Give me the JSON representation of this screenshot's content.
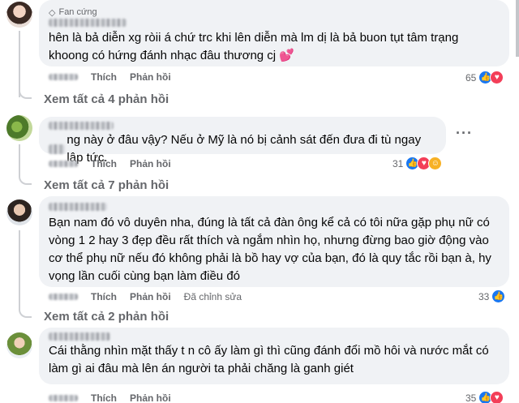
{
  "comments": [
    {
      "badge": "Fan cứng",
      "text": "hên là bả diễn xg ròii á chứ trc khi lên diễn mà lm dị là bả buon tụt tâm trạng khoong có hứng đánh nhạc đâu thương cj 💕",
      "like_label": "Thích",
      "reply_label": "Phản hồi",
      "reaction_count": "65",
      "view_replies": "Xem tất cả 4 phản hồi"
    },
    {
      "text": "ng này ở đâu vậy? Nếu ở Mỹ là nó bị cảnh sát đến đưa đi tù ngay lập tức.",
      "like_label": "Thích",
      "reply_label": "Phản hồi",
      "reaction_count": "31",
      "view_replies": "Xem tất cả 7 phản hồi"
    },
    {
      "text": "Bạn nam đó vô duyên nha, đúng là tất cả đàn ông kể cả có tôi nữa gặp phụ nữ có vòng 1 2 hay 3 đẹp đều rất thích và ngắm nhìn họ, nhưng đừng bao giờ động vào cơ thể phụ nữ nếu đó không phải là bồ hay vợ của bạn, đó là quy tắc rồi bạn à, hy vọng lần cuối cùng bạn làm điều đó",
      "like_label": "Thích",
      "reply_label": "Phản hồi",
      "edited_label": "Đã chỉnh sửa",
      "reaction_count": "33",
      "view_replies": "Xem tất cả 2 phản hồi"
    },
    {
      "text": "Cái thằng nhìn mặt thấy t  n cô ấy làm gì thì cũng đánh đổi mồ hôi và nước mắt có làm gì ai đâu mà lên án người ta phải chăng là ganh giét",
      "like_label": "Thích",
      "reply_label": "Phản hồi",
      "reaction_count": "35"
    }
  ],
  "icons": {
    "more": "more-horizontal-icon",
    "badge": "diamond-icon",
    "reply_curve": "reply-thread-icon"
  },
  "colors": {
    "bubble": "#f0f2f5",
    "muted": "#65676b",
    "like": "#1877f2",
    "love": "#f33e58",
    "care": "#f7b125"
  }
}
